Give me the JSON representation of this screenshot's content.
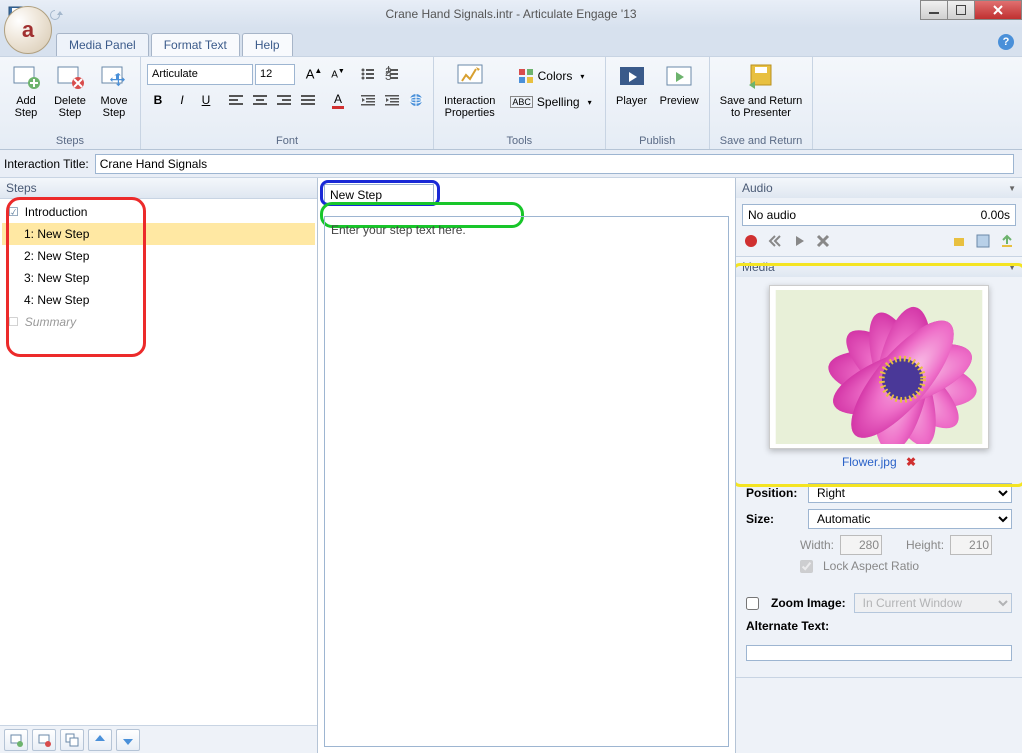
{
  "window": {
    "title": "Crane Hand Signals.intr -  Articulate Engage '13"
  },
  "tabs": {
    "media_panel": "Media Panel",
    "format_text": "Format Text",
    "help": "Help"
  },
  "ribbon": {
    "steps": {
      "label": "Steps",
      "add": "Add\nStep",
      "delete": "Delete\nStep",
      "move": "Move\nStep"
    },
    "font": {
      "label": "Font",
      "family": "Articulate",
      "size": "12"
    },
    "tools": {
      "label": "Tools",
      "interaction_props": "Interaction\nProperties",
      "colors": "Colors",
      "spelling": "Spelling"
    },
    "publish": {
      "label": "Publish",
      "player": "Player",
      "preview": "Preview"
    },
    "save": {
      "label": "Save and Return",
      "button": "Save and Return\nto Presenter"
    }
  },
  "interaction_title": {
    "label": "Interaction Title:",
    "value": "Crane Hand Signals"
  },
  "steps_panel": {
    "header": "Steps",
    "items": [
      {
        "label": "Introduction"
      },
      {
        "label": "1:  New Step"
      },
      {
        "label": "2:  New Step"
      },
      {
        "label": "3:  New Step"
      },
      {
        "label": "4:  New Step"
      },
      {
        "label": "Summary"
      }
    ]
  },
  "editor": {
    "step_title": "New Step",
    "placeholder": "Enter your step text here."
  },
  "audio": {
    "header": "Audio",
    "status": "No audio",
    "duration": "0.00s"
  },
  "media": {
    "header": "Media",
    "filename": "Flower.jpg",
    "position_label": "Position:",
    "position_value": "Right",
    "size_label": "Size:",
    "size_value": "Automatic",
    "width_label": "Width:",
    "width_value": "280",
    "height_label": "Height:",
    "height_value": "210",
    "lock_label": "Lock Aspect Ratio",
    "zoom_label": "Zoom Image:",
    "zoom_value": "In Current Window",
    "alt_label": "Alternate Text:"
  }
}
